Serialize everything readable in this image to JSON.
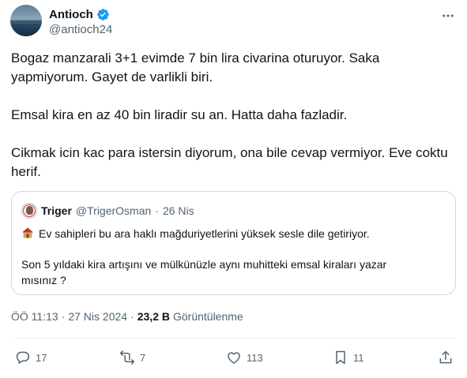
{
  "author": {
    "display_name": "Antioch",
    "handle": "@antioch24",
    "verified": true
  },
  "tweet": {
    "paragraphs": [
      [
        "Bogaz manzarali 3+1 evimde 7 bin lira civarina oturuyor. Saka",
        "yapmiyorum. Gayet de varlikli biri."
      ],
      [
        "Emsal kira en az 40 bin liradir su an. Hatta daha fazladir."
      ],
      [
        "Cikmak icin kac para istersin diyorum, ona bile cevap vermiyor. Eve coktu",
        "herif."
      ]
    ]
  },
  "quote": {
    "name": "Triger",
    "handle": "@TrigerOsman",
    "dot": "·",
    "date": "26 Nis",
    "icon": "house-icon",
    "line1": "Ev sahipleri bu ara haklı mağduriyetlerini yüksek sesle dile getiriyor.",
    "line2": "Son 5 yıldaki kira artışını ve mülkünüzle aynı muhitteki emsal kiraları yazar",
    "line3": "mısınız ?"
  },
  "meta": {
    "time": "ÖÖ 11:13",
    "dot1": "·",
    "date": "27 Nis 2024",
    "dot2": "·",
    "views_count": "23,2 B",
    "views_label": "Görüntülenme"
  },
  "actions": {
    "replies": "17",
    "retweets": "7",
    "likes": "113",
    "bookmarks": "11"
  },
  "colors": {
    "text": "#0f1419",
    "secondary": "#536471",
    "border": "#cfd9de",
    "verified": "#1d9bf0"
  }
}
